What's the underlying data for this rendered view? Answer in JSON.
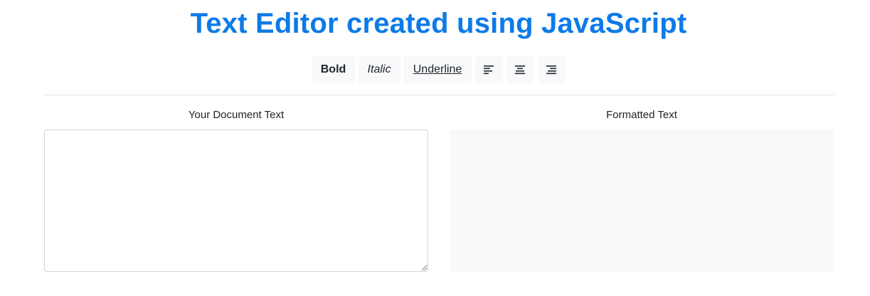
{
  "header": {
    "title": "Text Editor created using JavaScript"
  },
  "toolbar": {
    "bold_label": "Bold",
    "italic_label": "Italic",
    "underline_label": "Underline",
    "align_left_icon": "align-left-icon",
    "align_center_icon": "align-center-icon",
    "align_right_icon": "align-right-icon"
  },
  "editor": {
    "input_label": "Your Document Text",
    "input_value": "",
    "output_label": "Formatted Text",
    "output_value": ""
  },
  "colors": {
    "title": "#0d7ae8",
    "button_bg": "#f8f9fa",
    "output_bg": "#f8f9fa",
    "divider": "#dee2e6",
    "input_border": "#ced4da"
  }
}
